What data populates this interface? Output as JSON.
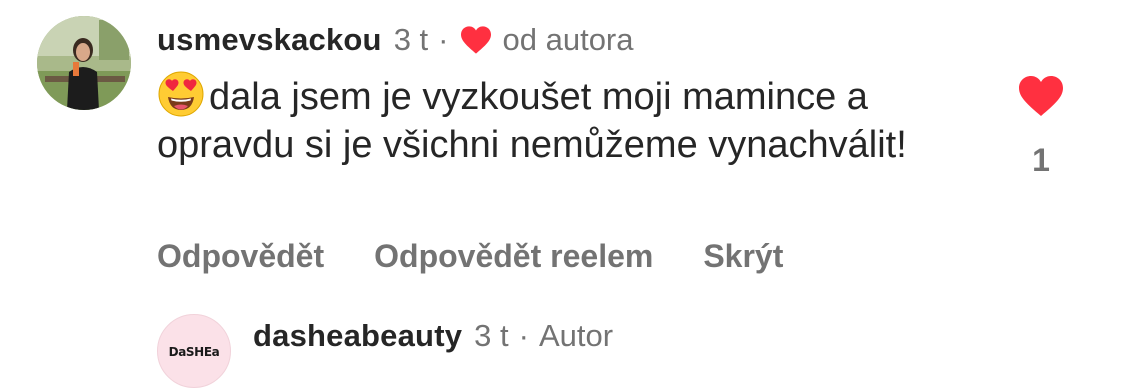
{
  "comment": {
    "username": "usmevskackou",
    "time": "3 t",
    "separator": "·",
    "liked_by_author_label": "od autora",
    "emoji": "heart-eyes-emoji",
    "text": "dala jsem je vyzkoušet moji mamince a opravdu si je všichni nemůžeme vynachválit!",
    "like_count": "1",
    "actions": {
      "reply": "Odpovědět",
      "reply_with_reel": "Odpovědět reelem",
      "hide": "Skrýt"
    }
  },
  "reply": {
    "username": "dasheabeauty",
    "time": "3 t",
    "separator": "·",
    "badge": "Autor",
    "avatar_logo": "DaSHEa"
  },
  "colors": {
    "heart": "#ff3040",
    "text_primary": "#262626",
    "text_secondary": "#737373"
  }
}
